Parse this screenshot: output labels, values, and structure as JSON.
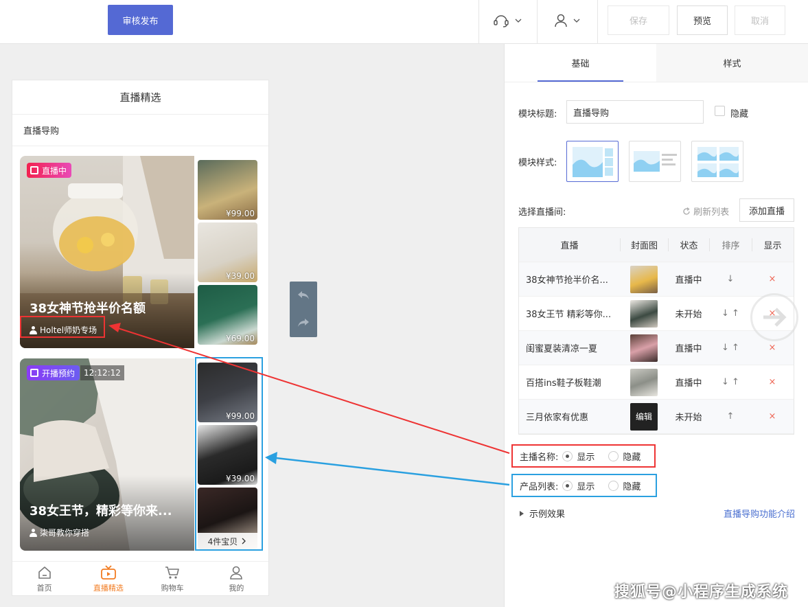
{
  "toolbar": {
    "publish_label": "审核发布",
    "save_label": "保存",
    "preview_label": "预览",
    "cancel_label": "取消"
  },
  "phone": {
    "title": "直播精选",
    "section_title": "直播导购",
    "cards": [
      {
        "badge": "直播中",
        "title": "38女神节抢半价名额",
        "anchor": "Holtel师奶专场",
        "prices": [
          "¥99.00",
          "¥39.00",
          "¥69.00"
        ]
      },
      {
        "badge": "开播预约",
        "timer": "12:12:12",
        "title": "38女王节，精彩等你来...",
        "anchor": "柒哥教你穿搭",
        "prices": [
          "¥99.00",
          "¥39.00"
        ],
        "more": "4件宝贝"
      }
    ],
    "tabs": [
      "首页",
      "直播精选",
      "购物车",
      "我的"
    ]
  },
  "panel": {
    "tabs": [
      "基础",
      "样式"
    ],
    "module_title_label": "模块标题:",
    "module_title_value": "直播导购",
    "hide_label": "隐藏",
    "module_style_label": "模块样式:",
    "select_room_label": "选择直播间:",
    "refresh_label": "刷新列表",
    "add_label": "添加直播",
    "table": {
      "headers": [
        "直播",
        "封面图",
        "状态",
        "排序",
        "显示"
      ],
      "rows": [
        {
          "name": "38女神节抢半价名...",
          "status": "直播中",
          "sort": "↓"
        },
        {
          "name": "38女王节 精彩等你...",
          "status": "未开始",
          "sort": "↓ ↑"
        },
        {
          "name": "闺蜜夏装清凉一夏",
          "status": "直播中",
          "sort": "↓ ↑"
        },
        {
          "name": "百搭ins鞋子板鞋潮",
          "status": "直播中",
          "sort": "↓ ↑"
        },
        {
          "name": "三月依家有优惠",
          "status": "未开始",
          "sort": "↑",
          "cover_text": "编辑"
        }
      ],
      "delete_symbol": "×"
    },
    "anchor_name_label": "主播名称:",
    "product_list_label": "产品列表:",
    "show_label": "显示",
    "hide_option_label": "隐藏",
    "example_label": "示例效果",
    "help_link": "直播导购功能介绍"
  },
  "watermark": "搜狐号@小程序生成系统",
  "colors": {
    "primary": "#5469d4",
    "live_badge": "#e8336a",
    "preview_badge": "#7b4df0",
    "active_tab": "#f27c22",
    "highlight_red": "#e33333",
    "highlight_blue": "#2aa0e0"
  }
}
